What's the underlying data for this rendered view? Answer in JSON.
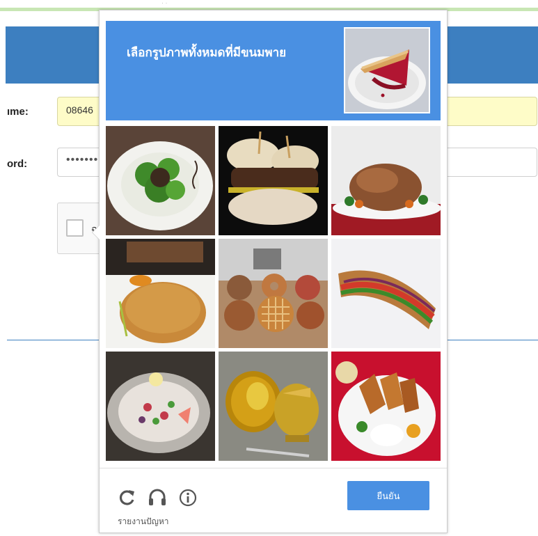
{
  "login_form": {
    "username_label": "ıme:",
    "username_value": "08646",
    "password_label": "ord:",
    "password_value": "•••••••",
    "captcha_anchor_label": "ฉ"
  },
  "challenge": {
    "instruction": "เลือกรูปภาพทั้งหมดที่มีขนมพาย",
    "sample_image_icon": "cherry-pie-slice-image",
    "tiles": [
      {
        "icon": "salad-plate-image"
      },
      {
        "icon": "burger-image"
      },
      {
        "icon": "roast-turkey-image"
      },
      {
        "icon": "pancake-plate-image"
      },
      {
        "icon": "pies-and-donuts-image"
      },
      {
        "icon": "sub-sandwich-image"
      },
      {
        "icon": "poke-bowl-image"
      },
      {
        "icon": "golden-teapot-image"
      },
      {
        "icon": "fried-chicken-plate-image"
      }
    ],
    "footer": {
      "reload_icon": "reload-icon",
      "audio_icon": "headphones-icon",
      "info_icon": "info-icon",
      "verify_label": "ยืนยัน",
      "report_label": "รายงานปัญหา"
    }
  },
  "colors": {
    "header_blue": "#4a90e2",
    "page_blue": "#3d7fc0",
    "username_field_bg": "#fefcc8"
  }
}
